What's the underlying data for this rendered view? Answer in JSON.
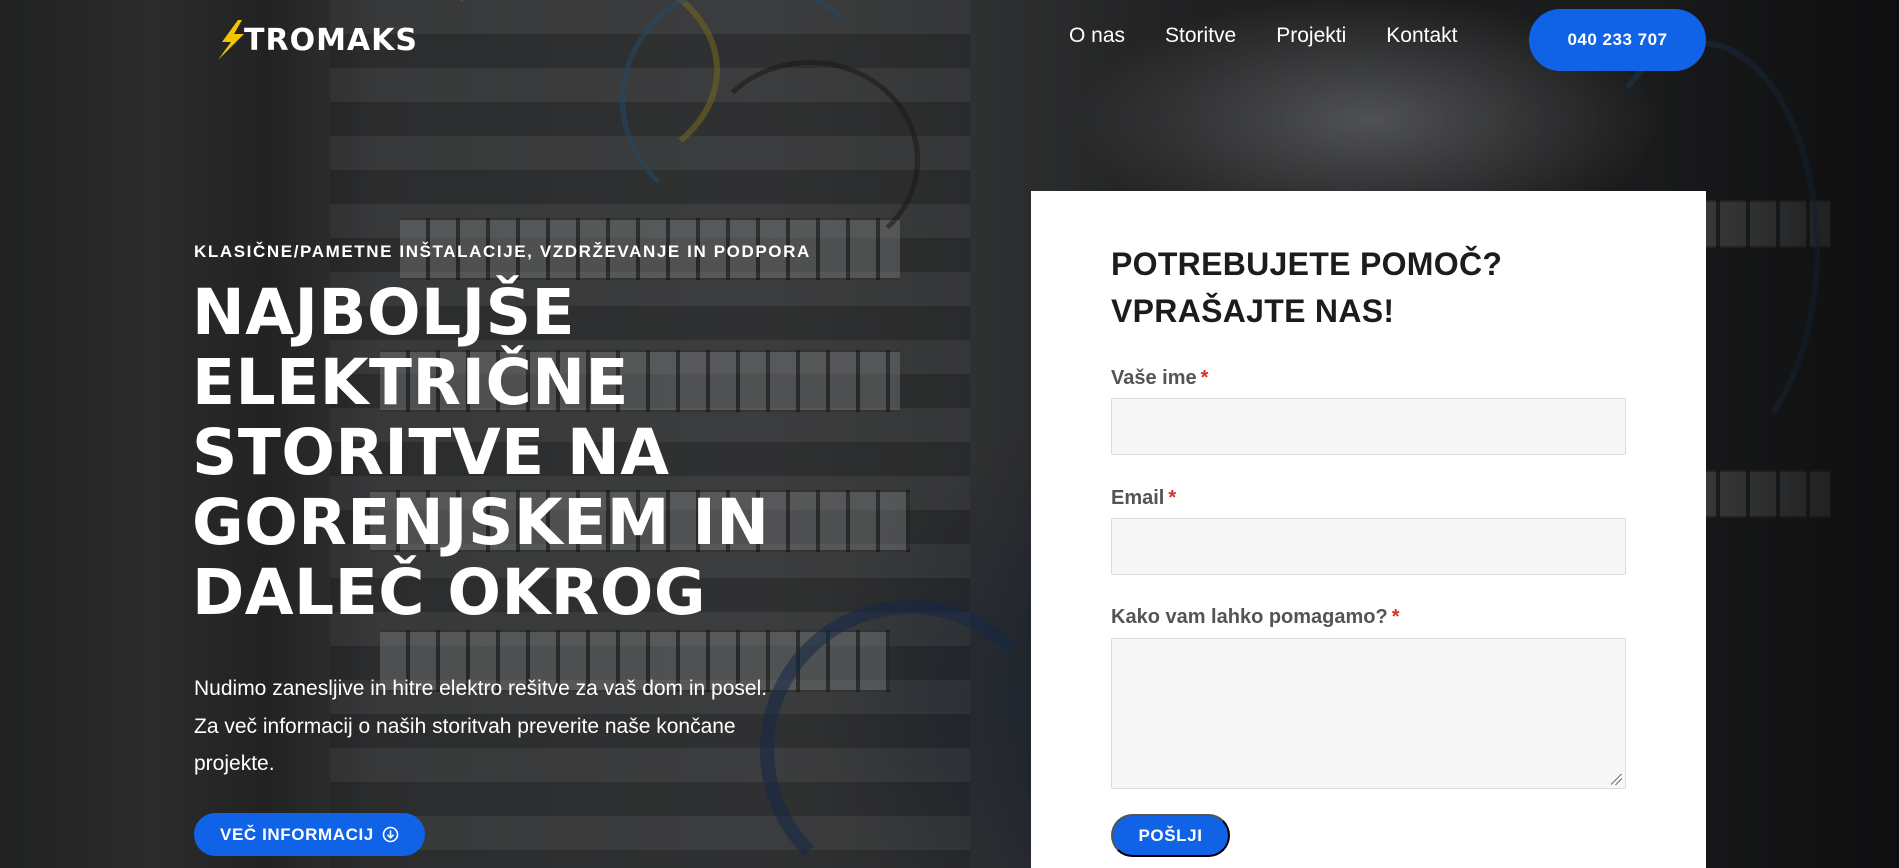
{
  "header": {
    "logo_text": "TROMAKS",
    "nav": [
      "O nas",
      "Storitve",
      "Projekti",
      "Kontakt"
    ],
    "phone_button": "040 233 707"
  },
  "hero": {
    "eyebrow": "KLASIČNE/PAMETNE INŠTALACIJE, VZDRŽEVANJE IN PODPORA",
    "headline_lines": [
      "NAJBOLJŠE",
      "ELEKTRIČNE",
      "STORITVE NA",
      "GORENJSKEM IN",
      "DALEČ OKROG"
    ],
    "lead_lines": [
      "Nudimo zanesljive in hitre elektro rešitve za vaš dom in posel.",
      "Za več informacij o naših storitvah preverite naše končane",
      "projekte."
    ],
    "more_button": "VEČ INFORMACIJ",
    "more_button_icon": "arrow-circle-down-icon"
  },
  "form": {
    "title_lines": [
      "POTREBUJETE POMOČ?",
      "VPRAŠAJTE NAS!"
    ],
    "fields": [
      {
        "label": "Vaše ime",
        "required_mark": "*",
        "value": ""
      },
      {
        "label": "Email",
        "required_mark": "*",
        "value": ""
      },
      {
        "label": "Kako vam lahko pomagamo?",
        "required_mark": "*",
        "value": ""
      }
    ],
    "submit": "POŠLJI"
  },
  "colors": {
    "accent": "#1063e6",
    "logo_bolt": "#f5c400",
    "required": "#d93025",
    "card_bg": "#ffffff",
    "field_bg": "#f7f7f7"
  }
}
